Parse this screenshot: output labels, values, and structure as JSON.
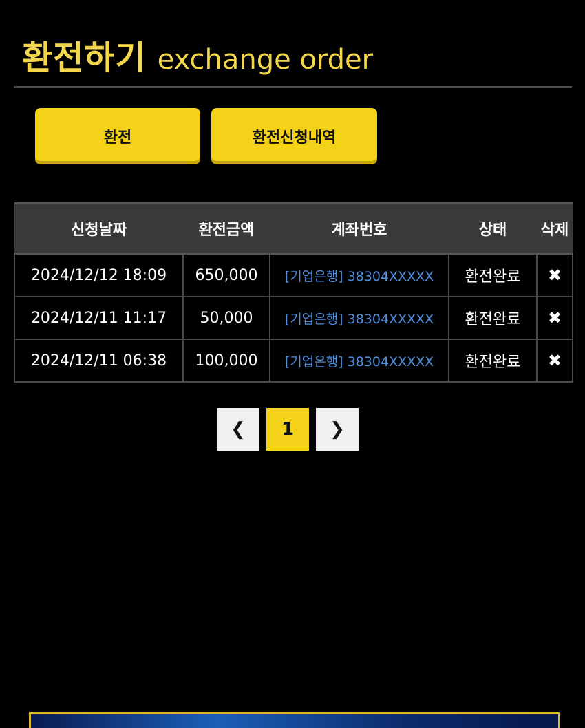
{
  "header": {
    "title_ko": "환전하기",
    "title_en": "exchange order"
  },
  "tabs": [
    {
      "label": "환전"
    },
    {
      "label": "환전신청내역"
    }
  ],
  "table": {
    "columns": [
      "신청날짜",
      "환전금액",
      "계좌번호",
      "상태",
      "삭제"
    ],
    "rows": [
      {
        "date": "2024/12/12 18:09",
        "amount": "650,000",
        "account": "[기업은행] 38304XXXXX",
        "status": "환전완료",
        "delete": "✖"
      },
      {
        "date": "2024/12/11 11:17",
        "amount": "50,000",
        "account": "[기업은행] 38304XXXXX",
        "status": "환전완료",
        "delete": "✖"
      },
      {
        "date": "2024/12/11 06:38",
        "amount": "100,000",
        "account": "[기업은행] 38304XXXXX",
        "status": "환전완료",
        "delete": "✖"
      }
    ]
  },
  "pagination": {
    "prev": "❮",
    "current": "1",
    "next": "❯"
  },
  "colors": {
    "accent": "#f4d21a",
    "title": "#f3d64a",
    "link": "#4f8fe0",
    "background": "#000000",
    "header_bg": "#3a3a3a"
  },
  "icons": {
    "delete": "close-icon",
    "prev": "chevron-left-icon",
    "next": "chevron-right-icon"
  }
}
